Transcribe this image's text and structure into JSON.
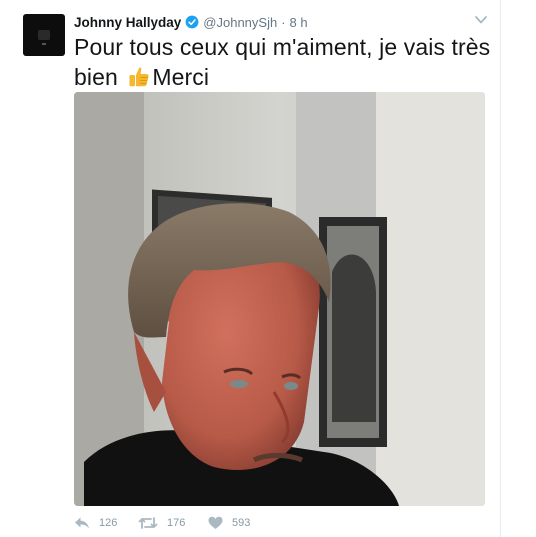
{
  "tweet": {
    "author_name": "Johnny Hallyday",
    "handle": "@JohnnySjh",
    "separator": "·",
    "time": "8 h",
    "text_part1": "Pour tous ceux qui m'aiment, je vais très bien",
    "text_part2": "Merci",
    "emoji": "thumbs-up",
    "media": "selfie-photo"
  },
  "actions": {
    "reply_count": "126",
    "retweet_count": "176",
    "like_count": "593"
  },
  "colors": {
    "verified": "#1da1f2",
    "muted": "#657786",
    "action_icons": "#aab8c2",
    "text": "#14171a"
  },
  "icons": {
    "verified": "verified-badge-icon",
    "menu": "chevron-down-icon",
    "reply": "reply-icon",
    "retweet": "retweet-icon",
    "like": "heart-icon"
  }
}
